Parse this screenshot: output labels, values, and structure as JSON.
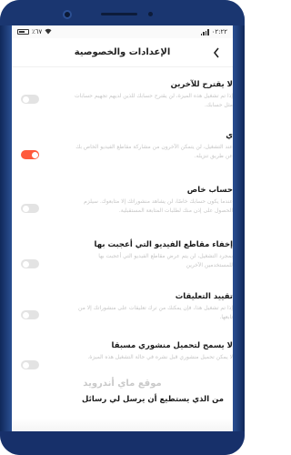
{
  "status_bar": {
    "time": "٠٢:٢٢",
    "battery": "٪٦٧"
  },
  "header": {
    "title": "الإعدادات والخصوصية"
  },
  "settings": [
    {
      "title": "لا يقترح للآخرين",
      "description": "إذا تم تشغيل هذه الميزة، لن يقترح حسابك للذين لديهم تجهيم حسابات مثل حسابك.",
      "enabled": false
    },
    {
      "title": "ي",
      "description": "عند التشغيل، لن يتمكن الآخرون من مشاركة مقاطع الفيديو الخاص بك عن طريق تنزيله.",
      "enabled": true
    },
    {
      "title": "حساب خاص",
      "description": "عندما يكون حسابك خاصًا، لن يشاهد منشوراتك إلا متابعوك. سيلزم الحصول على إذن منك لطلبات المتابعة المستقبلية.",
      "enabled": false
    },
    {
      "title": "إخفاء مقاطع الفيديو التي أعجبت بها",
      "description": "بمجرد التشغيل، لن يتم عرض مقاطع الفيديو التي أعجبت بها للمستخدمين الآخرين",
      "enabled": false
    },
    {
      "title": "تقييد التعليقات",
      "description": "إذا تم تشغيل هذا، فإن يمكنك من ترك تعليقات على منشوراتك إلا من تابعها.",
      "enabled": false
    },
    {
      "title": "لا يسمح لتحميل منشوري مسبقا",
      "description": "لا يمكن تحميل منشوري قبل نشره في حالة التشغيل هذه الميزة.",
      "enabled": false
    }
  ],
  "watermark": "موقع ماي أندرويد",
  "bottom_question": "من الذي يستطيع أن يرسل لي رسائل",
  "colors": {
    "toggle_on": "#ff5a3c",
    "toggle_off": "#e3e3e3",
    "frame": "#1e3f7c"
  }
}
